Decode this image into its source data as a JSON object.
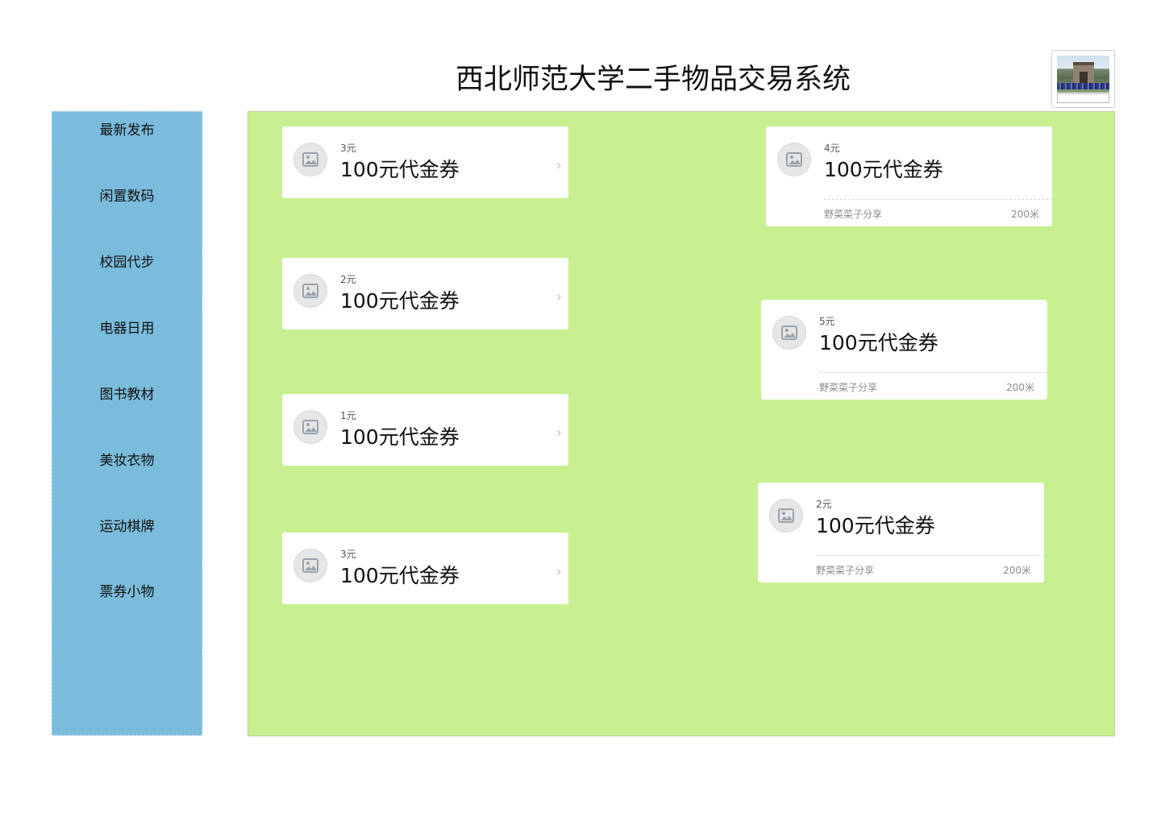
{
  "header": {
    "title": "西北师范大学二手物品交易系统"
  },
  "logo": {
    "icon": "campus-gate-photo"
  },
  "sidebar": {
    "items": [
      {
        "label": "最新发布"
      },
      {
        "label": "闲置数码"
      },
      {
        "label": "校园代步"
      },
      {
        "label": "电器日用"
      },
      {
        "label": "图书教材"
      },
      {
        "label": "美妆衣物"
      },
      {
        "label": "运动棋牌"
      },
      {
        "label": "票券小物"
      }
    ]
  },
  "colors": {
    "sidebar": "#7bbcdc",
    "main_panel": "#c8f090",
    "card": "#ffffff"
  },
  "listings_left": [
    {
      "price": "3元",
      "title": "100元代金券",
      "icon": "image-placeholder-icon",
      "chevron": "›"
    },
    {
      "price": "2元",
      "title": "100元代金券",
      "icon": "image-placeholder-icon",
      "chevron": "›"
    },
    {
      "price": "1元",
      "title": "100元代金券",
      "icon": "image-placeholder-icon",
      "chevron": "›"
    },
    {
      "price": "3元",
      "title": "100元代金券",
      "icon": "image-placeholder-icon",
      "chevron": "›"
    }
  ],
  "listings_right": [
    {
      "price": "4元",
      "title": "100元代金券",
      "source": "野菜菜子分享",
      "distance": "200米",
      "icon": "image-placeholder-icon"
    },
    {
      "price": "5元",
      "title": "100元代金券",
      "source": "野菜菜子分享",
      "distance": "200米",
      "icon": "image-placeholder-icon"
    },
    {
      "price": "2元",
      "title": "100元代金券",
      "source": "野菜菜子分享",
      "distance": "200米",
      "icon": "image-placeholder-icon"
    }
  ]
}
